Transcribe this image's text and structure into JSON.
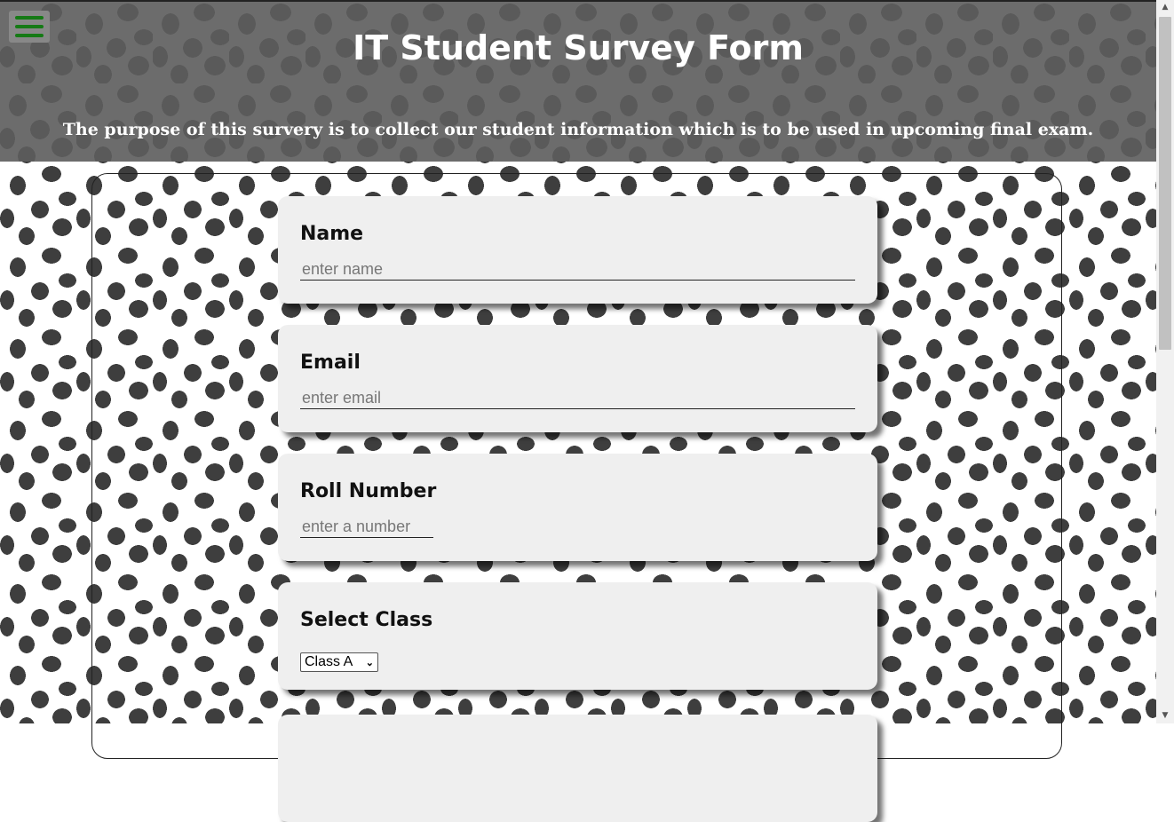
{
  "header": {
    "menu_icon": "hamburger-menu-icon",
    "title": "IT Student Survey Form",
    "description": "The purpose of this survery is to collect our student information which is to be used in upcoming final exam."
  },
  "form": {
    "name": {
      "label": "Name",
      "placeholder": "enter name"
    },
    "email": {
      "label": "Email",
      "placeholder": "enter email"
    },
    "roll": {
      "label": "Roll Number",
      "placeholder": "enter a number"
    },
    "class_select": {
      "label": "Select Class",
      "selected": "Class A"
    }
  },
  "colors": {
    "header_bg": "#6c6c6c",
    "menu_icon": "#157a15",
    "card_bg": "#efefef",
    "dot": "#3e3e3e"
  }
}
